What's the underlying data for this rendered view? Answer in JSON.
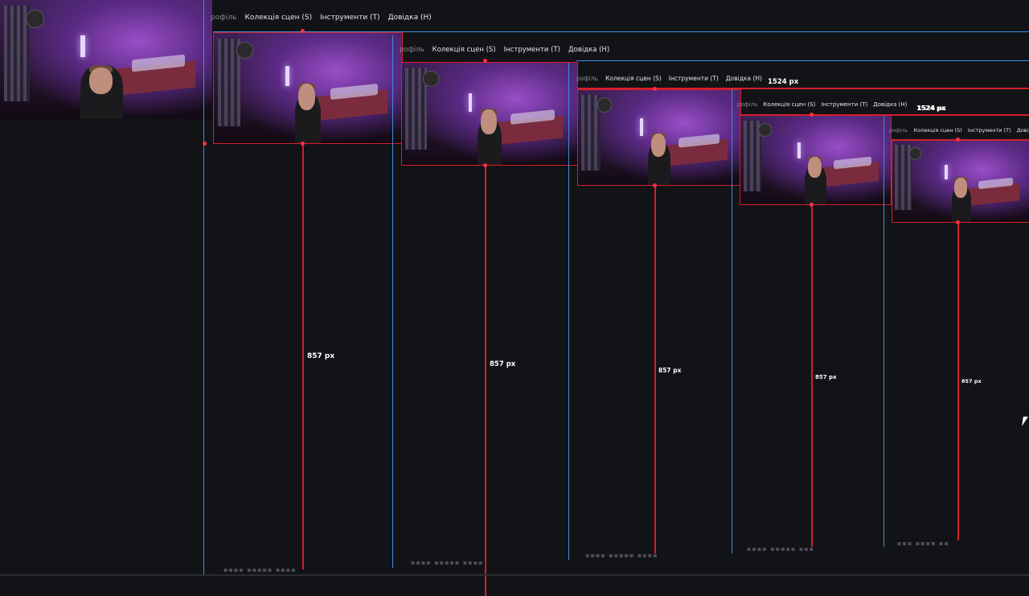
{
  "menu": {
    "profile": "рофіль",
    "scenes": "Колекція сцен (S)",
    "tools": "Інструменти (T)",
    "help": "Довідка (H)",
    "help_partial": "Довідка ("
  },
  "measurements": {
    "height": "857 px",
    "width": "1524 px"
  },
  "layers": [
    {
      "menu_items": [
        "profile",
        "scenes",
        "tools",
        "help"
      ]
    },
    {
      "menu_items": [
        "profile",
        "scenes",
        "tools",
        "help"
      ]
    },
    {
      "menu_items": [
        "profile",
        "scenes",
        "tools",
        "help"
      ]
    },
    {
      "menu_items": [
        "profile",
        "scenes",
        "tools",
        "help"
      ]
    },
    {
      "menu_items": [
        "profile",
        "scenes",
        "tools",
        "help_partial"
      ]
    }
  ],
  "colors": {
    "background": "#121317",
    "guide_red": "#d41e2a",
    "guide_blue": "#3d8ee0",
    "menu_text": "#e8e8e8"
  },
  "icons": {
    "cursor": "mouse-pointer-icon"
  }
}
